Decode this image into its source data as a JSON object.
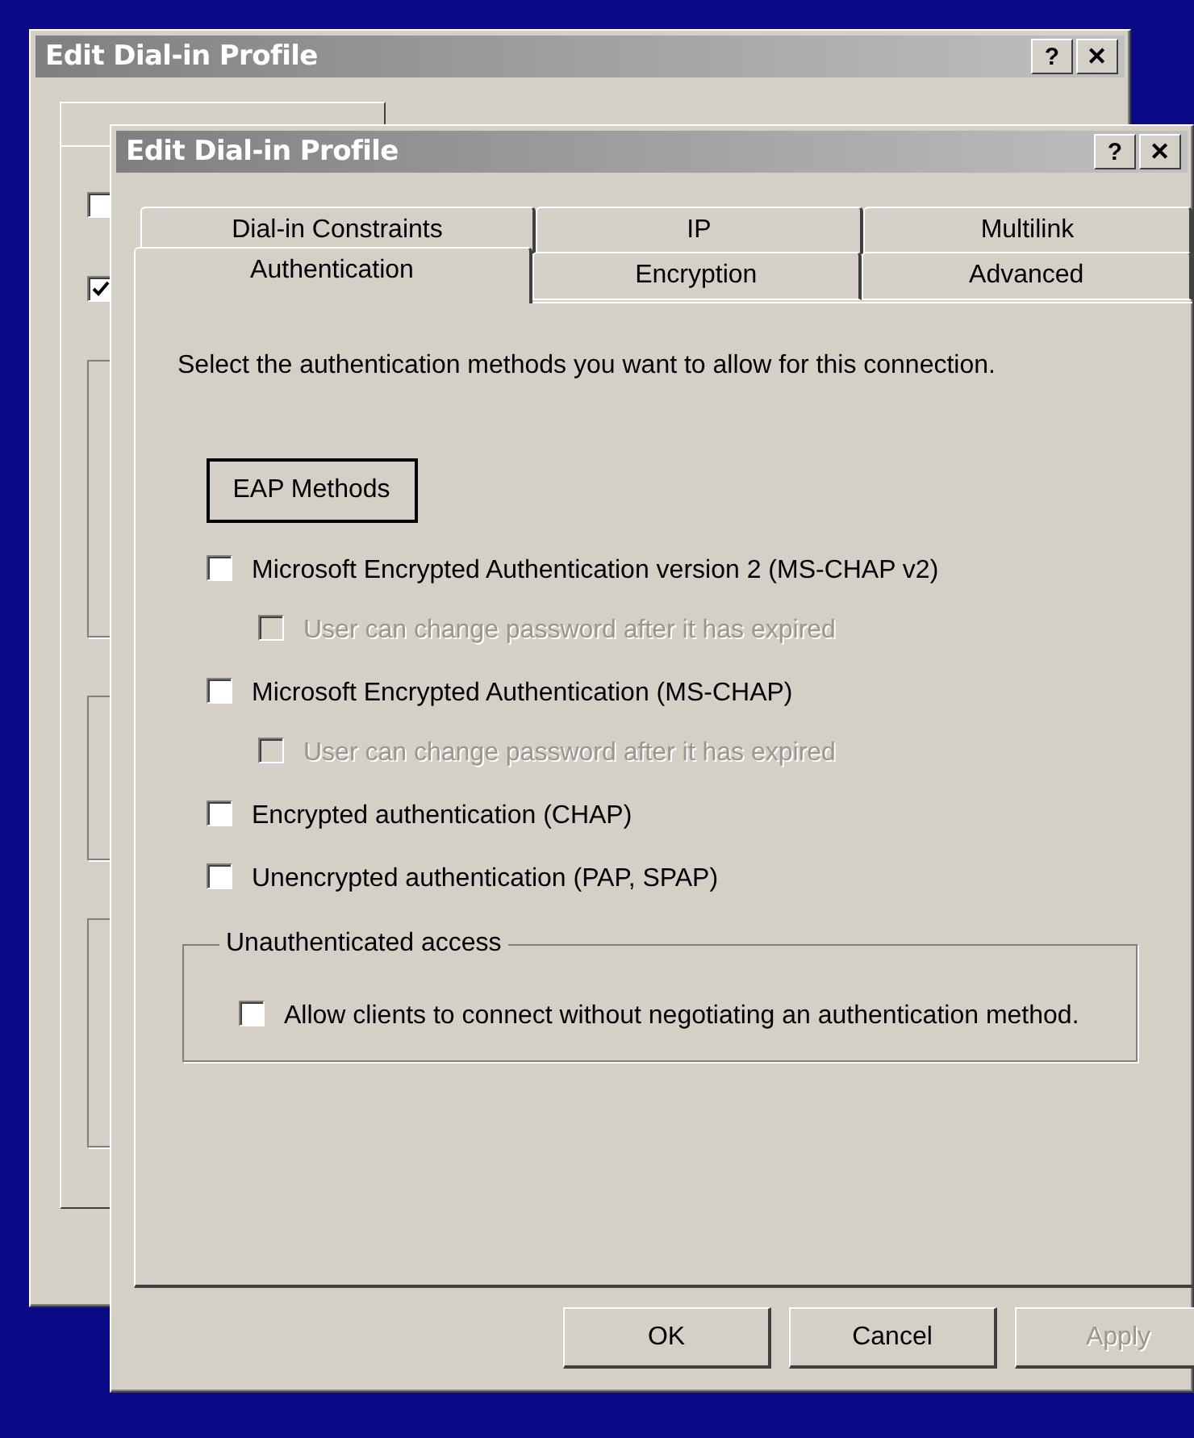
{
  "back_dialog": {
    "title": "Edit Dial-in Profile",
    "title_buttons": [
      "?",
      "✕"
    ],
    "checkboxes": [
      {
        "checked": false
      },
      {
        "checked": true
      }
    ]
  },
  "dialog": {
    "title": "Edit Dial-in Profile",
    "title_buttons": [
      "?",
      "✕"
    ]
  },
  "tab_rows": [
    {
      "tabs": [
        {
          "label": "Dial-in Constraints",
          "selected": false
        },
        {
          "label": "IP",
          "selected": false
        },
        {
          "label": "Multilink",
          "selected": false
        }
      ]
    },
    {
      "tabs": [
        {
          "label": "Authentication",
          "selected": true
        },
        {
          "label": "Encryption",
          "selected": false
        },
        {
          "label": "Advanced",
          "selected": false
        }
      ]
    }
  ],
  "intro": "Select the authentication methods you want to allow for this connection.",
  "eap_button": "EAP Methods",
  "options": [
    {
      "label": "Microsoft Encrypted Authentication version 2 (MS-CHAP v2)",
      "checked": false,
      "disabled": false,
      "children": [
        {
          "label": "User can change password after it has expired",
          "checked": false,
          "disabled": true
        }
      ]
    },
    {
      "label": "Microsoft Encrypted Authentication (MS-CHAP)",
      "checked": false,
      "disabled": false,
      "children": [
        {
          "label": "User can change password after it has expired",
          "checked": false,
          "disabled": true
        }
      ]
    },
    {
      "label": "Encrypted authentication (CHAP)",
      "checked": false,
      "disabled": false
    },
    {
      "label": "Unencrypted authentication (PAP, SPAP)",
      "checked": false,
      "disabled": false
    }
  ],
  "group": {
    "title": "Unauthenticated access",
    "option": {
      "label": "Allow clients to connect without negotiating an authentication method.",
      "checked": false,
      "disabled": false
    }
  },
  "buttons": [
    {
      "label": "OK",
      "disabled": false
    },
    {
      "label": "Cancel",
      "disabled": false
    },
    {
      "label": "Apply",
      "disabled": true
    }
  ]
}
